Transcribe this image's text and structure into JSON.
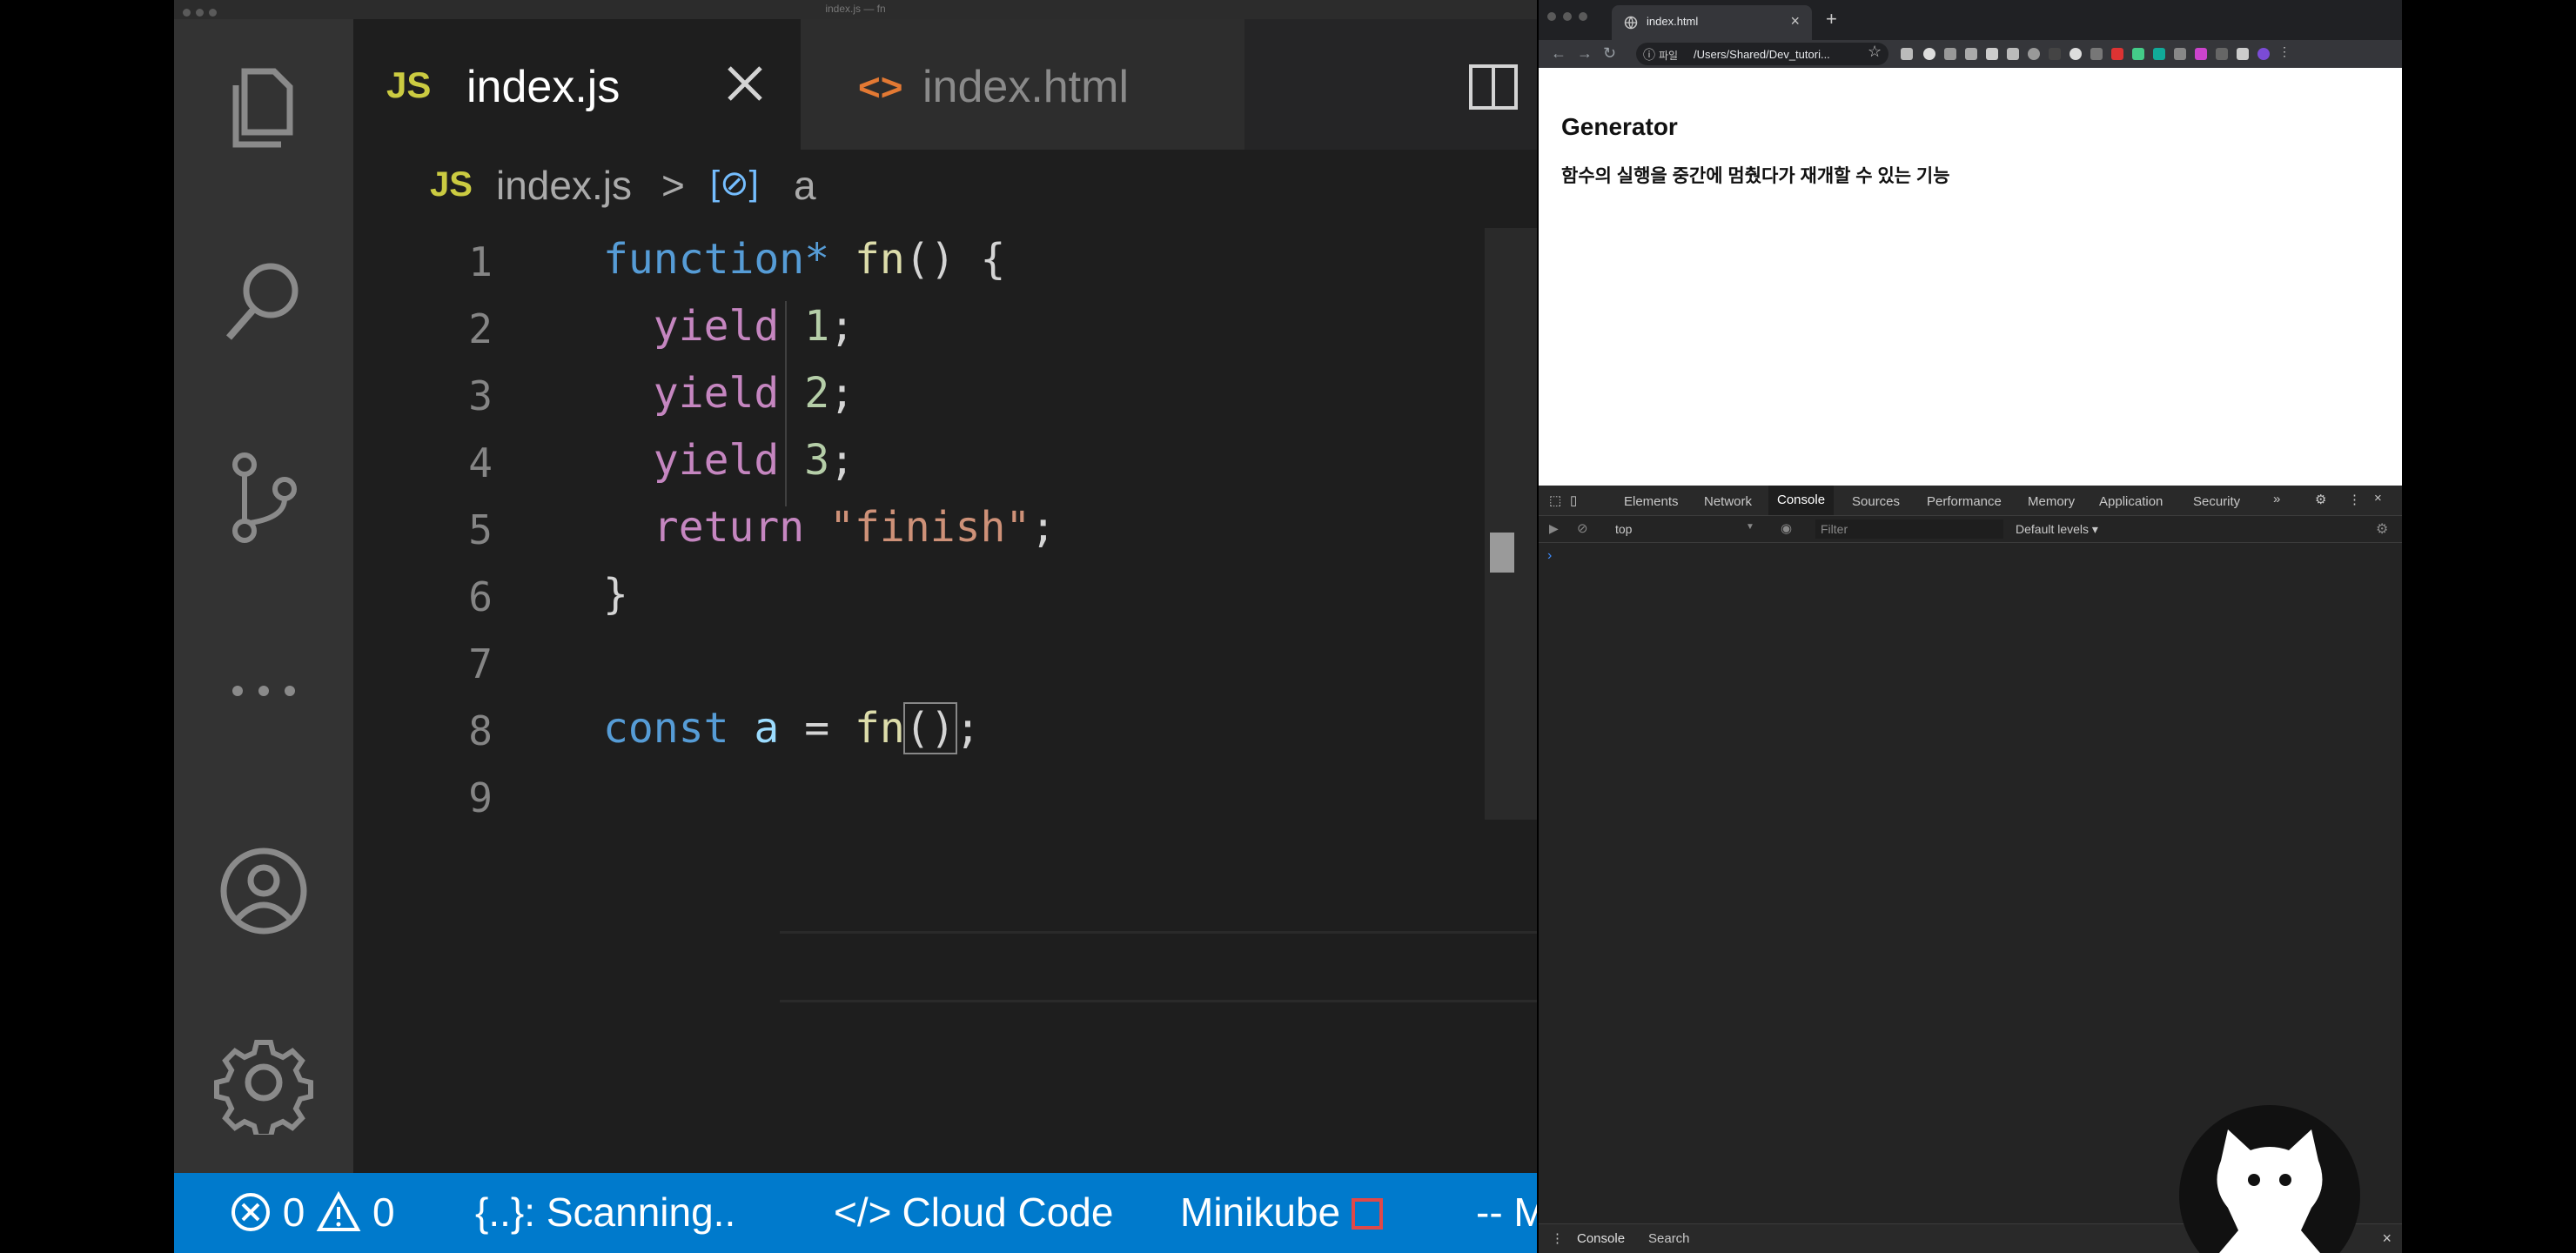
{
  "vscode": {
    "window_title": "index.js — fn",
    "tabs": [
      {
        "badge": "JS",
        "label": "index.js",
        "active": true
      },
      {
        "badge": "<>",
        "label": "index.html",
        "active": false
      }
    ],
    "more_actions": "···",
    "breadcrumb": {
      "badge": "JS",
      "file": "index.js",
      "separator": ">",
      "symbol_icon": "[⊘]",
      "symbol": "a"
    },
    "line_numbers": [
      "1",
      "2",
      "3",
      "4",
      "5",
      "6",
      "7",
      "8",
      "9"
    ],
    "code": {
      "l1": {
        "kw": "function*",
        "fn": "fn",
        "rest": "() {"
      },
      "l2": {
        "indent": "  ",
        "kw": "yield",
        "num": "1",
        "end": ";"
      },
      "l3": {
        "indent": "  ",
        "kw": "yield",
        "num": "2",
        "end": ";"
      },
      "l4": {
        "indent": "  ",
        "kw": "yield",
        "num": "3",
        "end": ";"
      },
      "l5": {
        "indent": "  ",
        "kw": "return",
        "str": "\"finish\"",
        "end": ";"
      },
      "l6": {
        "text": "}"
      },
      "l8": {
        "kw": "const",
        "var": "a",
        "op": "=",
        "fn": "fn",
        "paren": "()",
        "end": ";"
      }
    },
    "status": {
      "errors": "0",
      "warnings": "0",
      "scanning": "{..}: Scanning..",
      "cloud_code": "Cloud Code",
      "minikube": "Minikube",
      "truncated": "-- M"
    },
    "colors": {
      "status_bar": "#007acc",
      "editor_bg": "#1e1e1e",
      "activity_bar": "#333333"
    }
  },
  "browser": {
    "tab_title": "index.html",
    "close_tab": "×",
    "new_tab": "+",
    "nav": {
      "back": "←",
      "forward": "→",
      "reload": "↻"
    },
    "omnibox": {
      "info": "ⓘ",
      "scheme": "파일",
      "url": "/Users/Shared/Dev_tutori..."
    },
    "bookmark": "☆",
    "page": {
      "heading": "Generator",
      "paragraph": "함수의 실행을 중간에 멈췄다가 재개할 수 있는 기능"
    },
    "devtools": {
      "tabs": [
        "Elements",
        "Network",
        "Console",
        "Sources",
        "Performance",
        "Memory",
        "Application",
        "Security"
      ],
      "more_tabs": "»",
      "context": "top",
      "context_arrow": "▼",
      "filter_placeholder": "Filter",
      "levels": "Default levels ▾",
      "prompt": "›",
      "drawer_tabs": [
        "Console",
        "Search"
      ],
      "drawer_close": "×"
    }
  }
}
